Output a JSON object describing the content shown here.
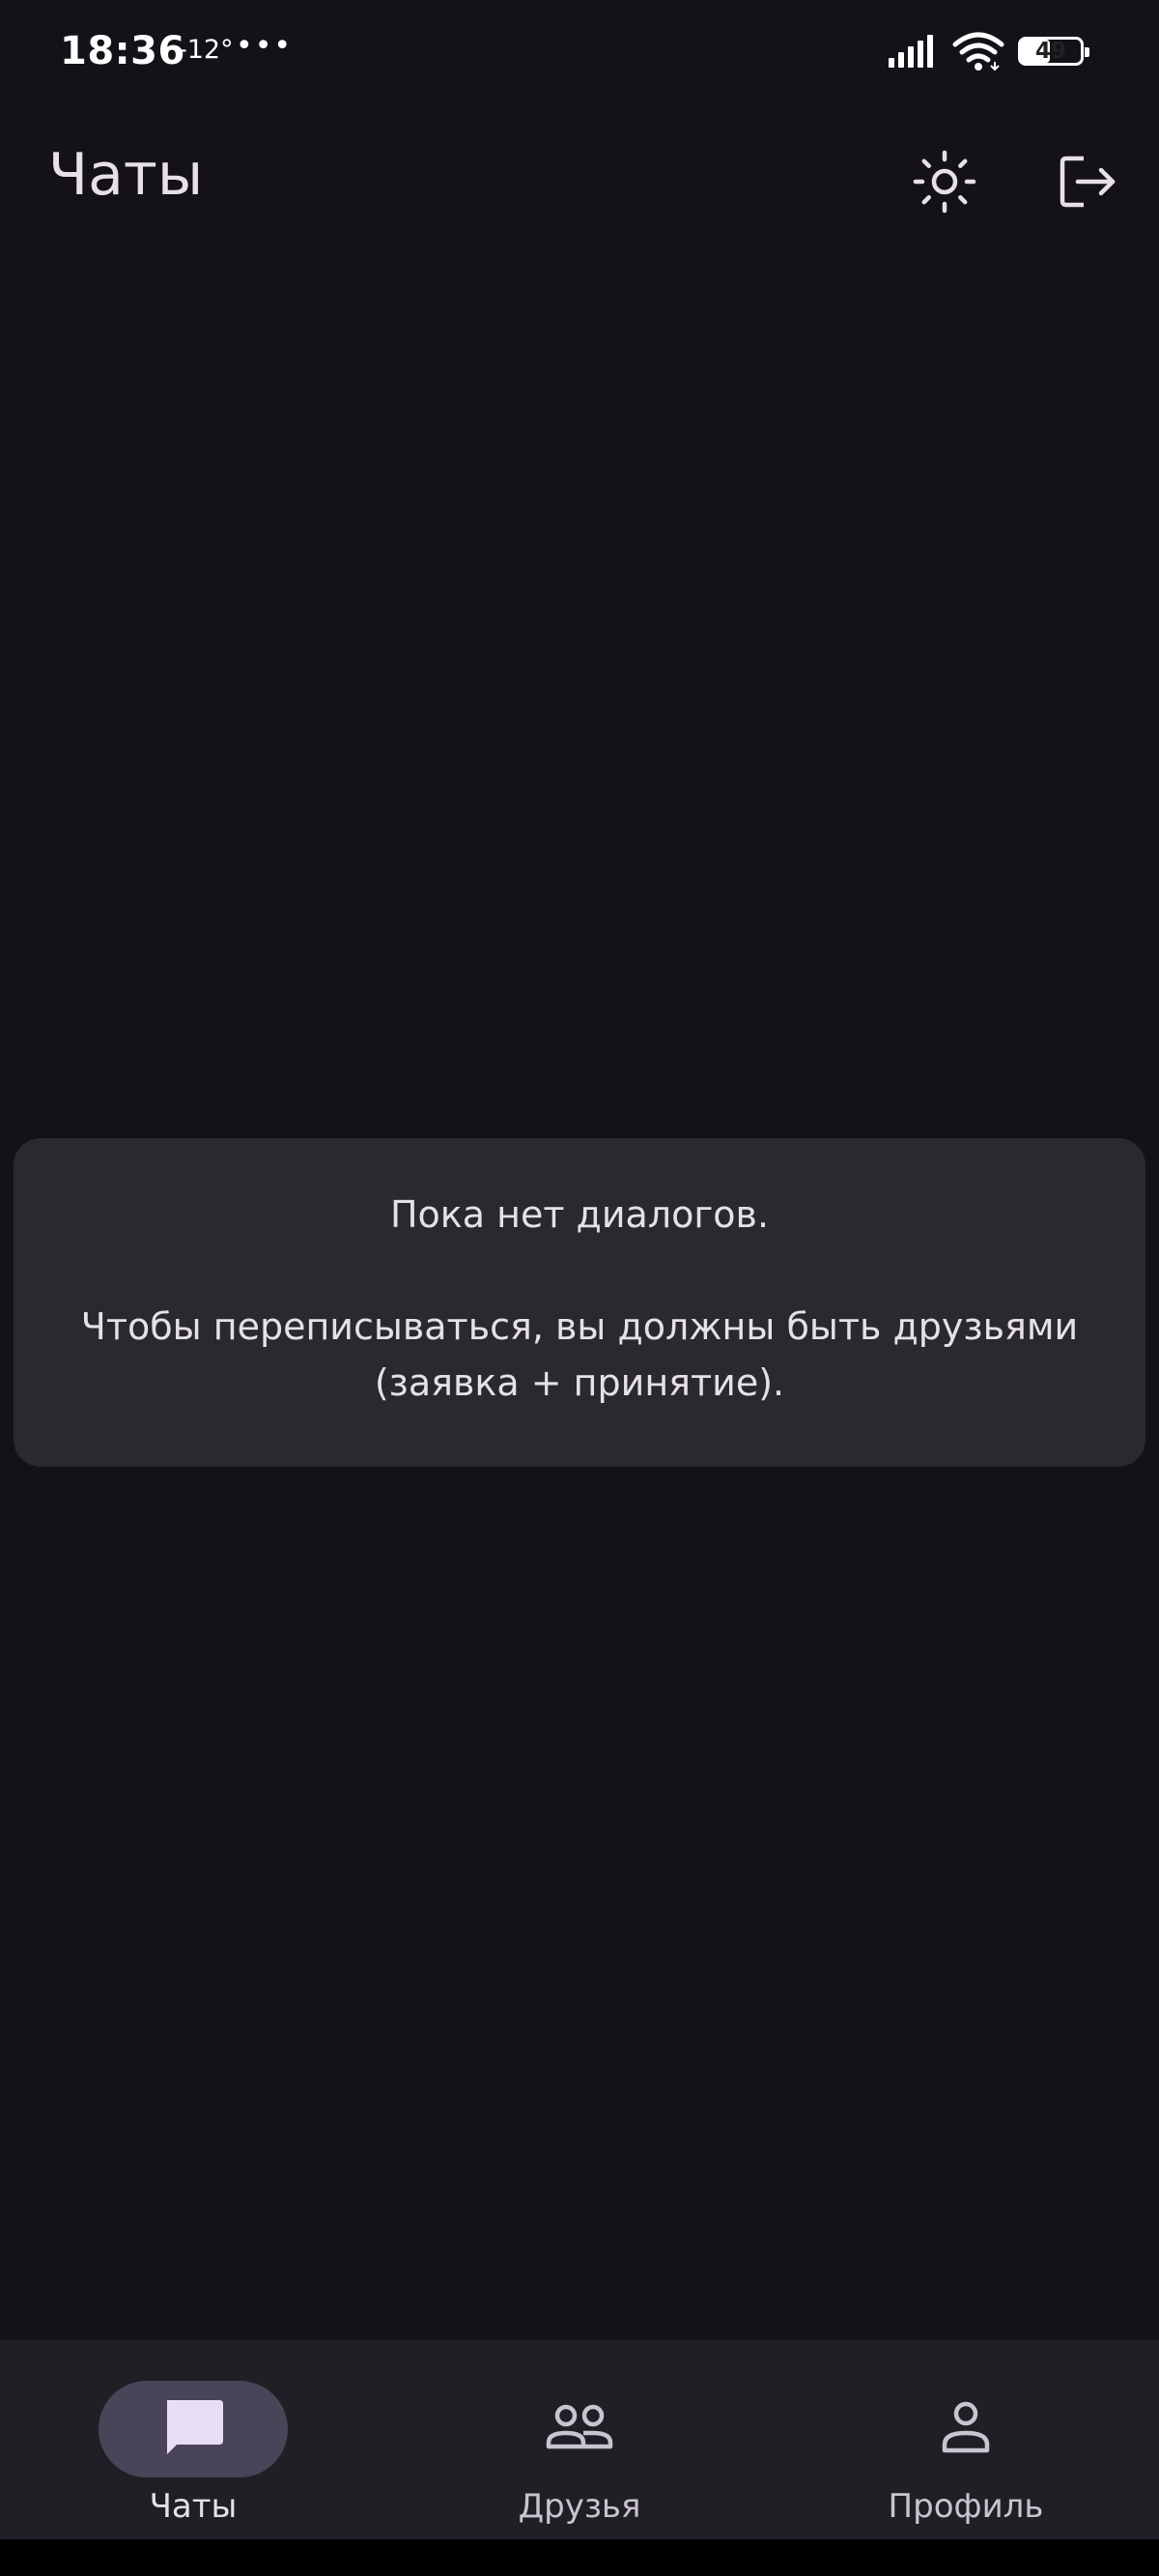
{
  "status_bar": {
    "time": "18:36",
    "temperature": "-12°",
    "more": "•••",
    "battery": "49"
  },
  "app_bar": {
    "title": "Чаты",
    "theme_icon": "sun-icon",
    "logout_icon": "logout-icon"
  },
  "empty_state": {
    "title": "Пока нет диалогов.",
    "body": "Чтобы переписываться, вы должны быть друзьями (заявка + принятие)."
  },
  "bottom_nav": {
    "items": [
      {
        "label": "Чаты",
        "icon": "chat-icon",
        "active": true
      },
      {
        "label": "Друзья",
        "icon": "friends-icon",
        "active": false
      },
      {
        "label": "Профиль",
        "icon": "profile-icon",
        "active": false
      }
    ]
  },
  "colors": {
    "background": "#141218",
    "card": "#2b2930",
    "nav_background": "#211f26",
    "nav_indicator": "#4a4458",
    "text": "#e6e0e9",
    "active_icon": "#e8def8"
  }
}
